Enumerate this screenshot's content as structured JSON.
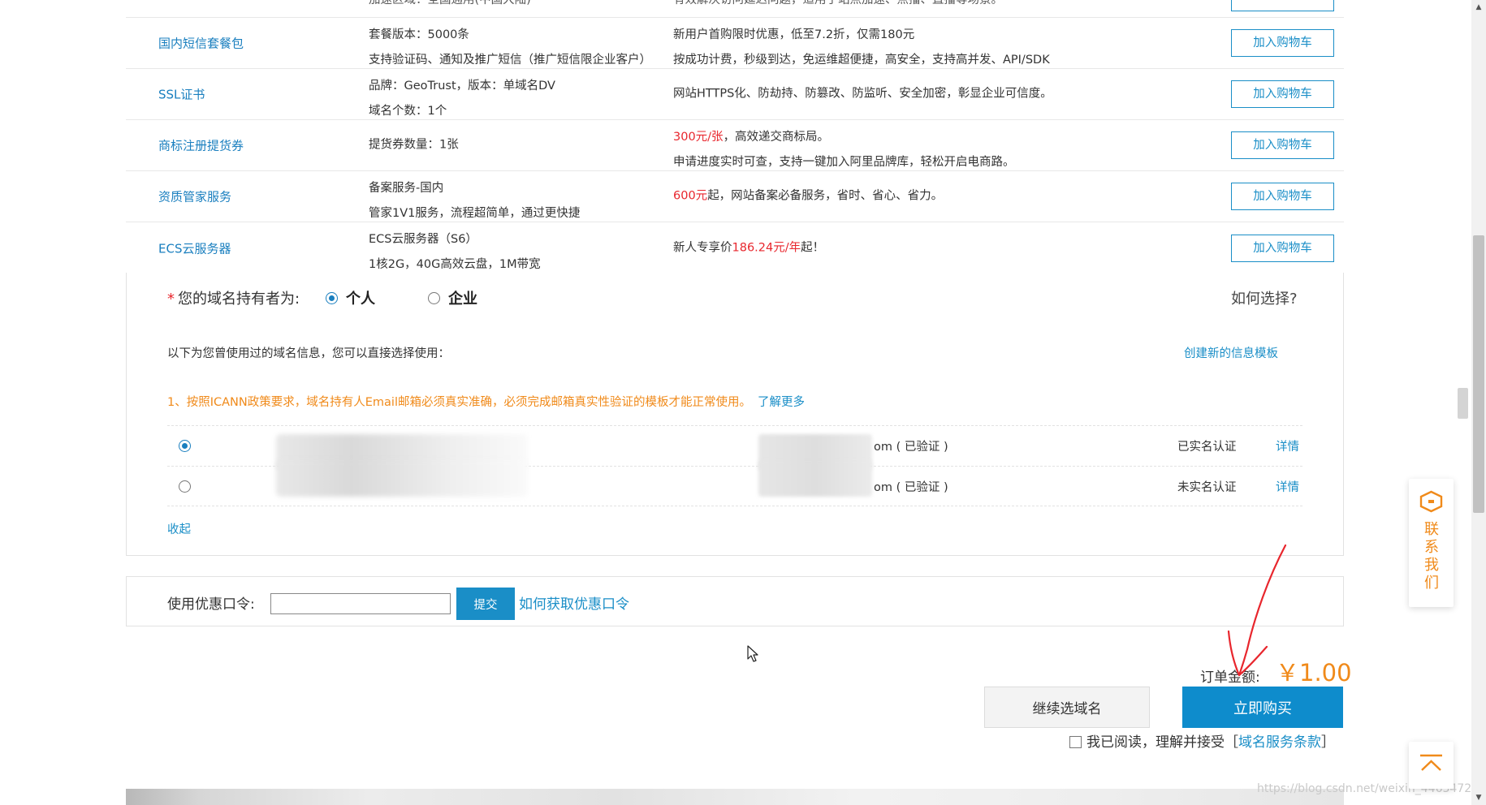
{
  "products": [
    {
      "name": "",
      "desc": [
        "加速区域：全国通用(中国大陆)"
      ],
      "feature": [
        "有效解决访问延迟问题，适用于站点加速、点播、直播等场景。"
      ],
      "button": ""
    },
    {
      "name": "国内短信套餐包",
      "desc": [
        "套餐版本：5000条",
        "支持验证码、通知及推广短信（推广短信限企业客户）"
      ],
      "feature": [
        "新用户首购限时优惠，低至7.2折，仅需180元",
        "按成功计费，秒级到达，免运维超便捷，高安全，支持高并发、API/SDK"
      ],
      "button": "加入购物车"
    },
    {
      "name": "SSL证书",
      "desc": [
        "品牌：GeoTrust，版本：单域名DV",
        "域名个数：1个"
      ],
      "feature": [
        "网站HTTPS化、防劫持、防篡改、防监听、安全加密，彰显企业可信度。"
      ],
      "button": "加入购物车"
    },
    {
      "name": "商标注册提货券",
      "desc": [
        "提货券数量：1张"
      ],
      "feature_price": "300元/张",
      "feature_price_suffix": "，高效递交商标局。",
      "feature_line2": "申请进度实时可查，支持一键加入阿里品牌库，轻松开启电商路。",
      "button": "加入购物车"
    },
    {
      "name": "资质管家服务",
      "desc": [
        "备案服务-国内",
        "管家1V1服务，流程超简单，通过更快捷"
      ],
      "feature_price": "600元",
      "feature_price_suffix": "起，网站备案必备服务，省时、省心、省力。",
      "button": "加入购物车"
    },
    {
      "name": "ECS云服务器",
      "desc": [
        "ECS云服务器（S6）",
        "1核2G，40G高效云盘，1M带宽"
      ],
      "feature_prefix": "新人专享价",
      "feature_price": "186.24元/年",
      "feature_suffix": "起！",
      "button": "加入购物车"
    }
  ],
  "holder": {
    "label": "您的域名持有者为:",
    "required_mark": "*",
    "option_personal": "个人",
    "option_enterprise": "企业",
    "how_choose": "如何选择?",
    "used_info_note": "以下为您曾使用过的域名信息，您可以直接选择使用：",
    "create_template": "创建新的信息模板",
    "icann_note": "1、按照ICANN政策要求，域名持有人Email邮箱必须真实准确，必须完成邮箱真实性验证的模板才能正常使用。",
    "learn_more": "了解更多",
    "templates": [
      {
        "email_suffix": "om ( 已验证 )",
        "status": "已实名认证",
        "detail": "详情",
        "selected": true
      },
      {
        "email_suffix": "om ( 已验证 )",
        "status": "未实名认证",
        "detail": "详情",
        "selected": false
      }
    ],
    "collapse": "收起"
  },
  "coupon": {
    "label": "使用优惠口令:",
    "input_value": "",
    "submit": "提交",
    "how_to_get": "如何获取优惠口令"
  },
  "order": {
    "amount_label": "订单金额:",
    "amount": "￥1.00",
    "continue_button": "继续选域名",
    "buy_button": "立即购买",
    "agree_text": "我已阅读，理解并接受［",
    "terms_link": "域名服务条款",
    "agree_close": "］"
  },
  "float_contact": {
    "chars": [
      "联",
      "系",
      "我",
      "们"
    ]
  },
  "watermark": "https://blog.csdn.net/weixin_44634727",
  "colors": {
    "accent": "#1a8ec7",
    "price_red": "#e8262d",
    "orange": "#f08a1a",
    "buy_button": "#0e8ccc"
  }
}
